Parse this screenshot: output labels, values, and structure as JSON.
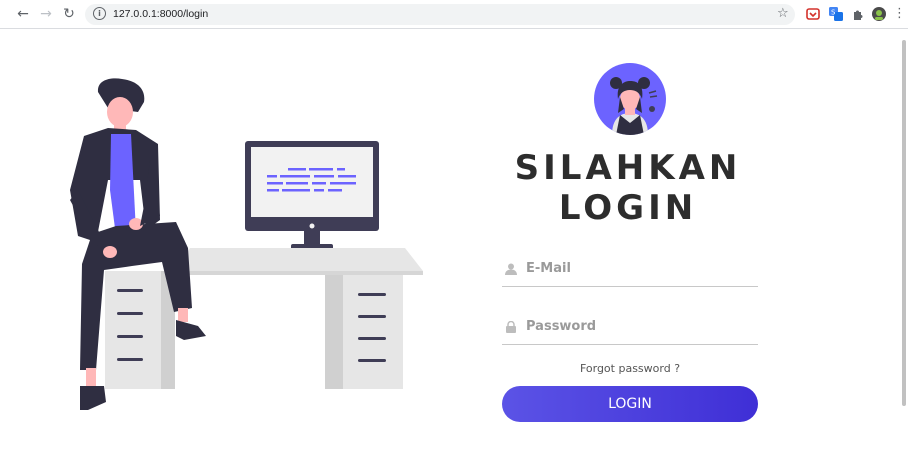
{
  "browser": {
    "url": "127.0.0.1:8000/login",
    "back_icon": "back-arrow-icon",
    "forward_icon": "forward-arrow-icon",
    "reload_icon": "reload-icon",
    "info_icon": "info-icon",
    "bookmark_icon": "star-icon",
    "extensions": [
      "pocket-extension-icon",
      "translate-extension-icon",
      "puzzle-extensions-icon",
      "profile-avatar-icon",
      "kebab-menu-icon"
    ]
  },
  "login": {
    "title_line1": "SILAHKAN",
    "title_line2": "LOGIN",
    "email_placeholder": "E-Mail",
    "password_placeholder": "Password",
    "forgot_label": "Forgot password ?",
    "button_label": "LOGIN",
    "email_icon": "user-icon",
    "password_icon": "lock-icon"
  },
  "colors": {
    "accent": "#6c63ff",
    "button_start": "#5b53e6",
    "button_end": "#3f2fd6",
    "title_text": "#2d2d2d",
    "figure_dark": "#2f2e41",
    "desk_grey": "#e6e6e6"
  }
}
